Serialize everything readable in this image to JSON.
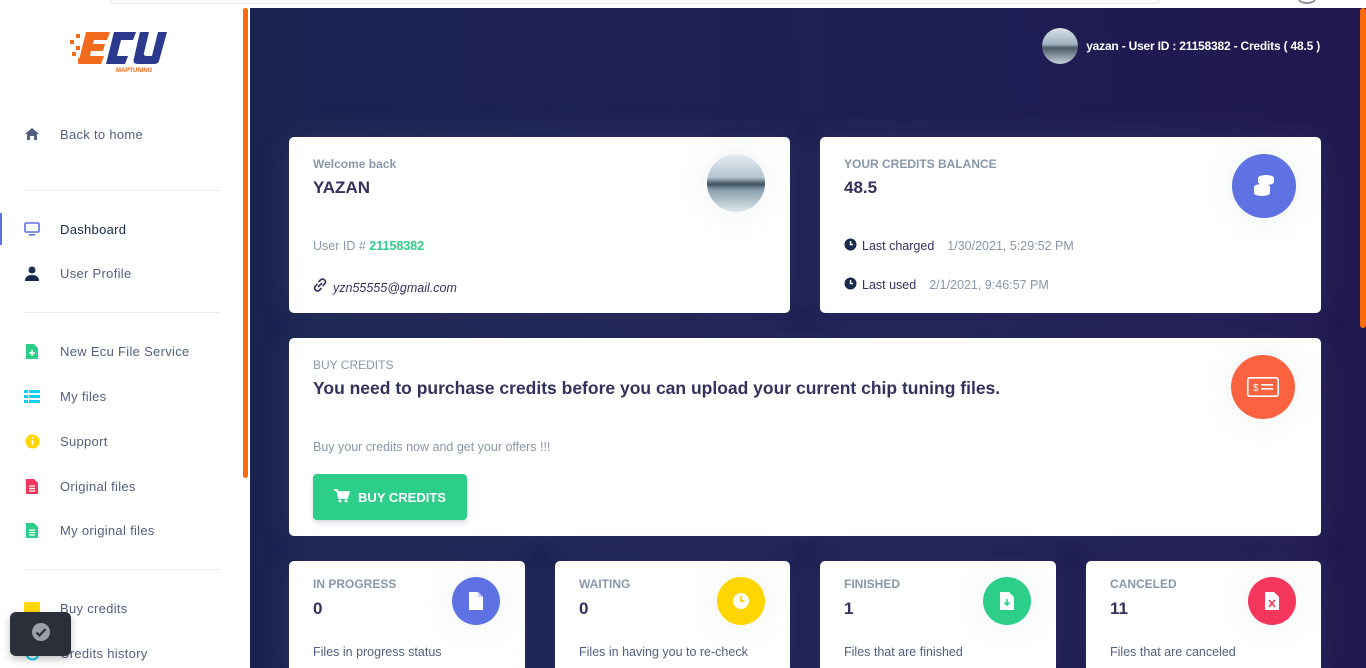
{
  "brand": {
    "logo_text": "ECU",
    "logo_sub": "MAPTUNING"
  },
  "sidebar": {
    "items": [
      {
        "label": "Back to home",
        "icon": "home-icon"
      },
      {
        "label": "Dashboard",
        "icon": "monitor-icon"
      },
      {
        "label": "User Profile",
        "icon": "user-icon"
      },
      {
        "label": "New Ecu File Service",
        "icon": "file-plus-icon"
      },
      {
        "label": "My files",
        "icon": "list-icon"
      },
      {
        "label": "Support",
        "icon": "info-icon"
      },
      {
        "label": "Original files",
        "icon": "file-icon"
      },
      {
        "label": "My original files",
        "icon": "file-text-icon"
      },
      {
        "label": "Buy credits",
        "icon": "credit-icon"
      },
      {
        "label": "Credits history",
        "icon": "history-icon"
      }
    ]
  },
  "header": {
    "user_text": "yazan - User ID : 21158382 - Credits ( 48.5 )"
  },
  "welcome": {
    "title": "Welcome back",
    "name": "YAZAN",
    "user_id_label": "User ID #",
    "user_id": "21158382",
    "email": "yzn55555@gmail.com"
  },
  "credits": {
    "title": "YOUR CREDITS BALANCE",
    "value": "48.5",
    "last_charged_label": "Last charged",
    "last_charged": "1/30/2021, 5:29:52 PM",
    "last_used_label": "Last used",
    "last_used": "2/1/2021, 9:46:57 PM"
  },
  "buy": {
    "title": "BUY CREDITS",
    "headline": "You need to purchase credits before you can upload your current chip tuning files.",
    "sub": "Buy your credits now and get your offers !!!",
    "button": "BUY CREDITS"
  },
  "stats": [
    {
      "title": "IN PROGRESS",
      "value": "0",
      "desc": "Files in progress status",
      "color": "#5e72e4",
      "icon": "file-icon"
    },
    {
      "title": "WAITING",
      "value": "0",
      "desc": "Files in having you to re-check",
      "color": "#ffd600",
      "icon": "clock-icon"
    },
    {
      "title": "FINISHED",
      "value": "1",
      "desc": "Files that are finished",
      "color": "#2dce89",
      "icon": "download-file-icon"
    },
    {
      "title": "CANCELED",
      "value": "11",
      "desc": "Files that are canceled",
      "color": "#f5365c",
      "icon": "excel-file-icon"
    }
  ],
  "colors": {
    "accent": "#5e72e4",
    "success": "#2dce89",
    "warning": "#ffd600",
    "danger": "#f5365c",
    "orange": "#fb6340",
    "sidebar_scroll": "#fb6b0a",
    "main_bg": "#1e1e55"
  }
}
